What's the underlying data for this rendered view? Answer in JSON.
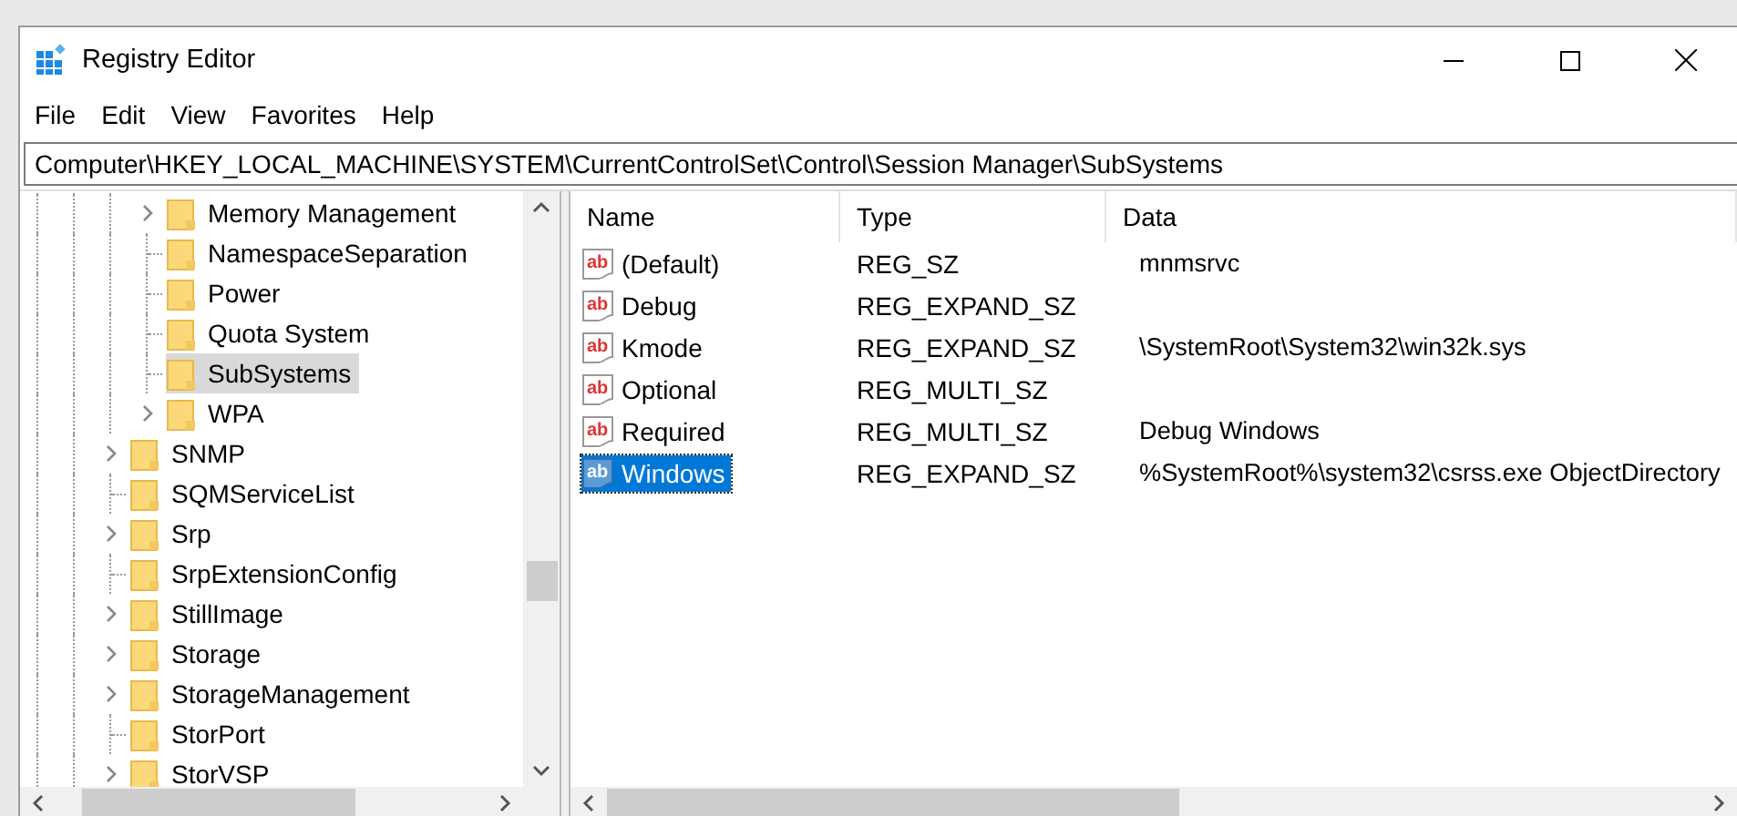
{
  "window": {
    "title": "Registry Editor"
  },
  "menu": [
    "File",
    "Edit",
    "View",
    "Favorites",
    "Help"
  ],
  "address": "Computer\\HKEY_LOCAL_MACHINE\\SYSTEM\\CurrentControlSet\\Control\\Session Manager\\SubSystems",
  "tree": {
    "items": [
      {
        "children": [
          {
            "label": "Memory Management",
            "expandable": true,
            "selected": false
          },
          {
            "label": "NamespaceSeparation",
            "expandable": false,
            "selected": false
          },
          {
            "label": "Power",
            "expandable": false,
            "selected": false
          },
          {
            "label": "Quota System",
            "expandable": false,
            "selected": false
          },
          {
            "label": "SubSystems",
            "expandable": false,
            "selected": true
          },
          {
            "label": "WPA",
            "expandable": true,
            "selected": false
          }
        ]
      },
      {
        "label": "SNMP",
        "expandable": true,
        "selected": false
      },
      {
        "label": "SQMServiceList",
        "expandable": false,
        "selected": false
      },
      {
        "label": "Srp",
        "expandable": true,
        "selected": false
      },
      {
        "label": "SrpExtensionConfig",
        "expandable": false,
        "selected": false
      },
      {
        "label": "StillImage",
        "expandable": true,
        "selected": false
      },
      {
        "label": "Storage",
        "expandable": true,
        "selected": false
      },
      {
        "label": "StorageManagement",
        "expandable": true,
        "selected": false
      },
      {
        "label": "StorPort",
        "expandable": false,
        "selected": false
      },
      {
        "label": "StorVSP",
        "expandable": true,
        "selected": false
      }
    ]
  },
  "values": {
    "columns": [
      "Name",
      "Type",
      "Data"
    ],
    "rows": [
      {
        "icon": "ab",
        "name": "(Default)",
        "type": "REG_SZ",
        "data": "mnmsrvc",
        "selected": false
      },
      {
        "icon": "ab",
        "name": "Debug",
        "type": "REG_EXPAND_SZ",
        "selected": false
      },
      {
        "icon": "ab",
        "name": "Kmode",
        "type": "REG_EXPAND_SZ",
        "data": "\\SystemRoot\\System32\\win32k.sys",
        "selected": false
      },
      {
        "icon": "ab",
        "name": "Optional",
        "type": "REG_MULTI_SZ",
        "selected": false
      },
      {
        "icon": "ab",
        "name": "Required",
        "type": "REG_MULTI_SZ",
        "data": "Debug Windows",
        "selected": false
      },
      {
        "icon": "ab",
        "name": "Windows",
        "type": "REG_EXPAND_SZ",
        "data": "%SystemRoot%\\system32\\csrss.exe ObjectDirectory",
        "selected": true
      }
    ]
  }
}
